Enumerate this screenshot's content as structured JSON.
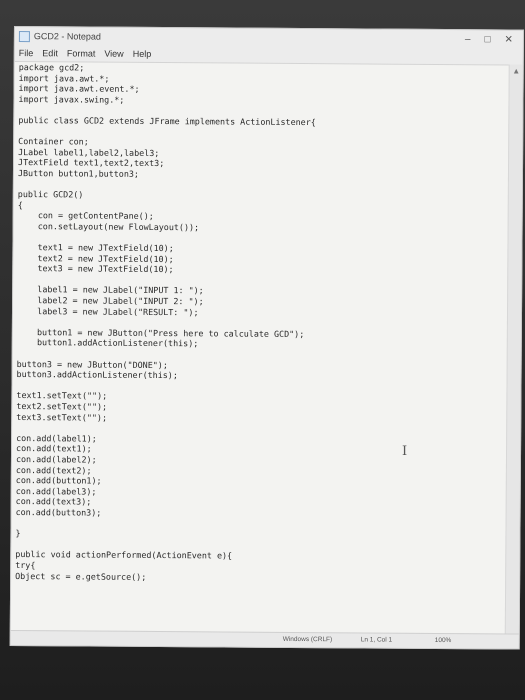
{
  "window": {
    "title": "GCD2 - Notepad",
    "controls": {
      "minimize": "–",
      "maximize": "□",
      "close": "✕"
    }
  },
  "menu": [
    "File",
    "Edit",
    "Format",
    "View",
    "Help"
  ],
  "editor": {
    "lines": [
      "package gcd2;",
      "import java.awt.*;",
      "import java.awt.event.*;",
      "import javax.swing.*;",
      "",
      "public class GCD2 extends JFrame implements ActionListener{",
      "",
      "Container con;",
      "JLabel label1,label2,label3;",
      "JTextField text1,text2,text3;",
      "JButton button1,button3;",
      "",
      "public GCD2()",
      "{",
      "    con = getContentPane();",
      "    con.setLayout(new FlowLayout());",
      "",
      "    text1 = new JTextField(10);",
      "    text2 = new JTextField(10);",
      "    text3 = new JTextField(10);",
      "",
      "    label1 = new JLabel(\"INPUT 1: \");",
      "    label2 = new JLabel(\"INPUT 2: \");",
      "    label3 = new JLabel(\"RESULT: \");",
      "",
      "    button1 = new JButton(\"Press here to calculate GCD\");",
      "    button1.addActionListener(this);",
      "",
      "button3 = new JButton(\"DONE\");",
      "button3.addActionListener(this);",
      "",
      "text1.setText(\"\");",
      "text2.setText(\"\");",
      "text3.setText(\"\");",
      "",
      "con.add(label1);",
      "con.add(text1);",
      "con.add(label2);",
      "con.add(text2);",
      "con.add(button1);",
      "con.add(label3);",
      "con.add(text3);",
      "con.add(button3);",
      "",
      "}",
      "",
      "public void actionPerformed(ActionEvent e){",
      "try{",
      "Object sc = e.getSource();"
    ]
  },
  "status": {
    "encoding": "Windows (CRLF)",
    "position": "Ln 1, Col 1",
    "zoom": "100%"
  }
}
